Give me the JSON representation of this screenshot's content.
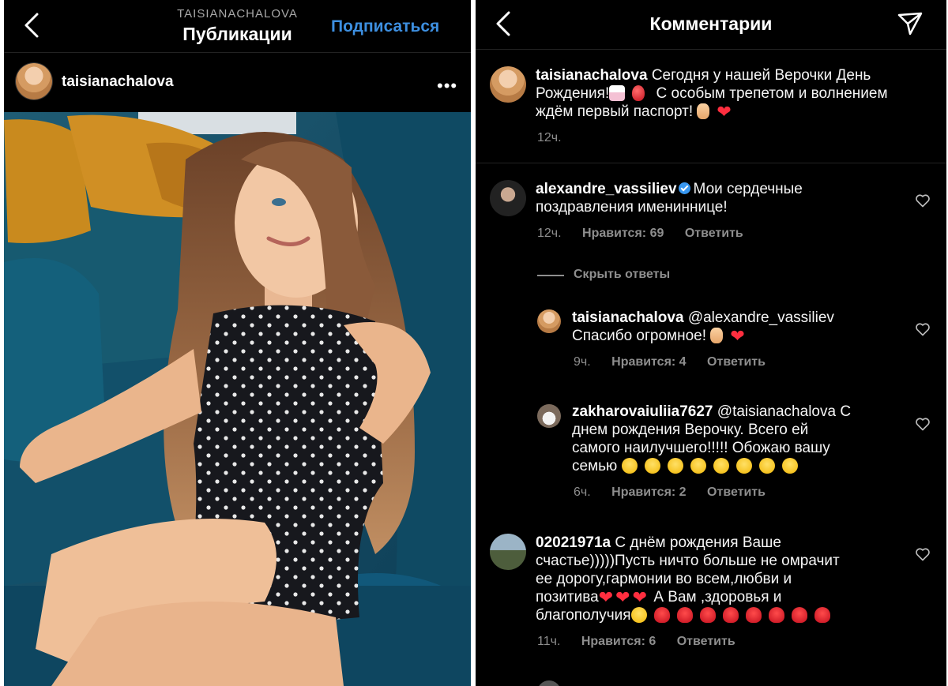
{
  "left": {
    "account_caption": "TAISIANACHALOVA",
    "title": "Публикации",
    "follow_label": "Подписаться",
    "post_username": "taisianachalova",
    "more_label": "•••"
  },
  "right": {
    "title": "Комментарии",
    "caption": {
      "username": "taisianachalova",
      "line1": "Сегодня у нашей Верочки День",
      "line2a": "Рождения!",
      "line2b": "С особым трепетом и волнением",
      "line3": "ждём первый паспорт!",
      "time": "12ч."
    },
    "comments": [
      {
        "username": "alexandre_vassiliev",
        "line1": "Мои сердечные",
        "line2": "поздравления имениннице!",
        "time": "12ч.",
        "likes": "Нравится: 69",
        "reply": "Ответить"
      },
      {
        "username": "02021971a",
        "line1": "С днём рождения Ваше",
        "line2": "счастье)))))Пусть ничто больше не омрачит",
        "line3": "ее дорогу,гармонии во всем,любви и",
        "line4a": "позитива",
        "line4b": "А Вам ,здоровья и",
        "line5": "благополучия",
        "time": "11ч.",
        "likes": "Нравится: 6",
        "reply": "Ответить"
      }
    ],
    "hide_replies": "Скрыть ответы",
    "replies": [
      {
        "username": "taisianachalova",
        "mention": "@alexandre_vassiliev",
        "line2": "Спасибо огромное!",
        "time": "9ч.",
        "likes": "Нравится: 4",
        "reply": "Ответить"
      },
      {
        "username": "zakharovaiuliia7627",
        "mention": "@taisianachalova С",
        "line2": "днем рождения Верочку. Всего ей",
        "line3": "самого наилучшего!!!!! Обожаю вашу",
        "line4": "семью",
        "time": "6ч.",
        "likes": "Нравится: 2",
        "reply": "Ответить"
      }
    ]
  }
}
